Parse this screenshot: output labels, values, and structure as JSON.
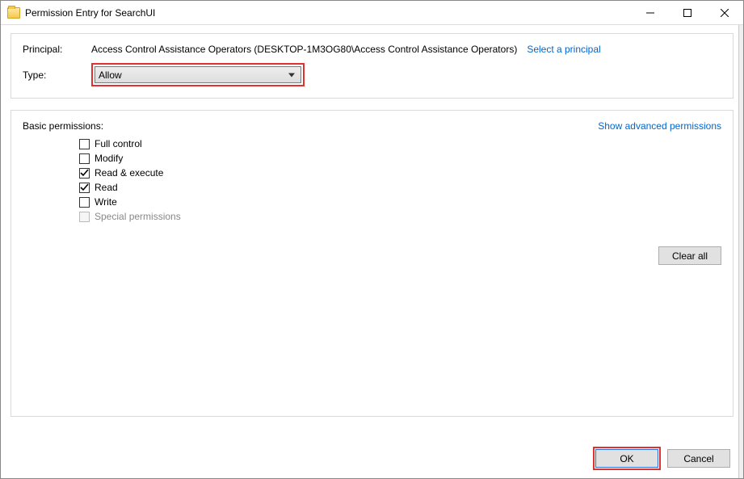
{
  "window": {
    "title": "Permission Entry for SearchUI"
  },
  "principal": {
    "label": "Principal:",
    "value": "Access Control Assistance Operators (DESKTOP-1M3OG80\\Access Control Assistance Operators)",
    "select_link": "Select a principal"
  },
  "type": {
    "label": "Type:",
    "selected": "Allow"
  },
  "permissions": {
    "header": "Basic permissions:",
    "advanced_link": "Show advanced permissions",
    "items": [
      {
        "label": "Full control",
        "checked": false,
        "disabled": false
      },
      {
        "label": "Modify",
        "checked": false,
        "disabled": false
      },
      {
        "label": "Read & execute",
        "checked": true,
        "disabled": false
      },
      {
        "label": "Read",
        "checked": true,
        "disabled": false
      },
      {
        "label": "Write",
        "checked": false,
        "disabled": false
      },
      {
        "label": "Special permissions",
        "checked": false,
        "disabled": true
      }
    ],
    "clear_label": "Clear all"
  },
  "buttons": {
    "ok": "OK",
    "cancel": "Cancel"
  },
  "highlight": {
    "color": "#e03030"
  }
}
